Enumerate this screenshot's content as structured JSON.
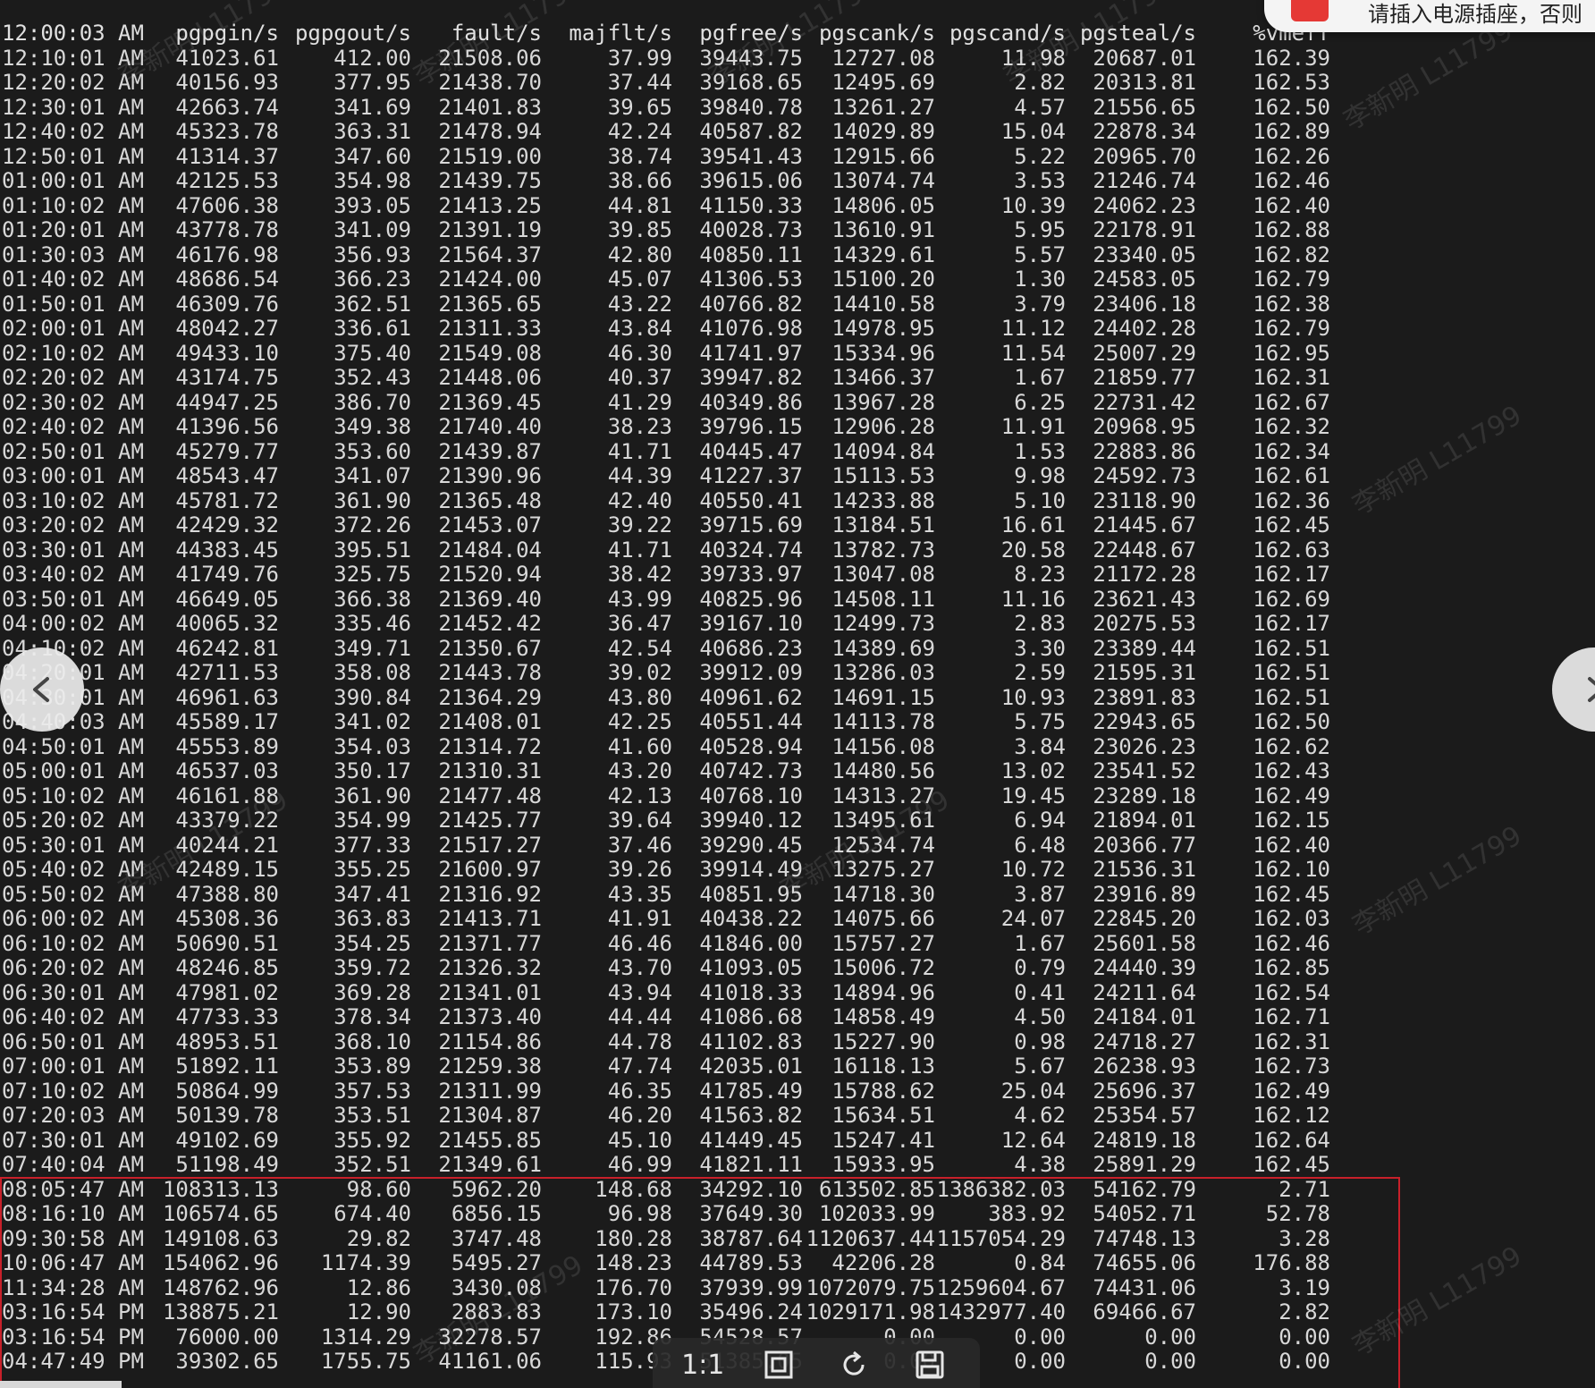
{
  "notification": {
    "text": "请插入电源插座，否则"
  },
  "watermark_text": "李新明 L11799",
  "terminal": {
    "headers": [
      "12:00:03 AM",
      "pgpgin/s",
      "pgpgout/s",
      "fault/s",
      "majflt/s",
      "pgfree/s",
      "pgscank/s",
      "pgscand/s",
      "pgsteal/s",
      "%vmeff"
    ],
    "rows": [
      [
        "12:10:01 AM",
        "41023.61",
        "412.00",
        "21508.06",
        "37.99",
        "39443.75",
        "12727.08",
        "11.98",
        "20687.01",
        "162.39"
      ],
      [
        "12:20:02 AM",
        "40156.93",
        "377.95",
        "21438.70",
        "37.44",
        "39168.65",
        "12495.69",
        "2.82",
        "20313.81",
        "162.53"
      ],
      [
        "12:30:01 AM",
        "42663.74",
        "341.69",
        "21401.83",
        "39.65",
        "39840.78",
        "13261.27",
        "4.57",
        "21556.65",
        "162.50"
      ],
      [
        "12:40:02 AM",
        "45323.78",
        "363.31",
        "21478.94",
        "42.24",
        "40587.82",
        "14029.89",
        "15.04",
        "22878.34",
        "162.89"
      ],
      [
        "12:50:01 AM",
        "41314.37",
        "347.60",
        "21519.00",
        "38.74",
        "39541.43",
        "12915.66",
        "5.22",
        "20965.70",
        "162.26"
      ],
      [
        "01:00:01 AM",
        "42125.53",
        "354.98",
        "21439.75",
        "38.66",
        "39615.06",
        "13074.74",
        "3.53",
        "21246.74",
        "162.46"
      ],
      [
        "01:10:02 AM",
        "47606.38",
        "393.05",
        "21413.25",
        "44.81",
        "41150.33",
        "14806.05",
        "10.39",
        "24062.23",
        "162.40"
      ],
      [
        "01:20:01 AM",
        "43778.78",
        "341.09",
        "21391.19",
        "39.85",
        "40028.73",
        "13610.91",
        "5.95",
        "22178.91",
        "162.88"
      ],
      [
        "01:30:03 AM",
        "46176.98",
        "356.93",
        "21564.37",
        "42.80",
        "40850.11",
        "14329.61",
        "5.57",
        "23340.05",
        "162.82"
      ],
      [
        "01:40:02 AM",
        "48686.54",
        "366.23",
        "21424.00",
        "45.07",
        "41306.53",
        "15100.20",
        "1.30",
        "24583.05",
        "162.79"
      ],
      [
        "01:50:01 AM",
        "46309.76",
        "362.51",
        "21365.65",
        "43.22",
        "40766.82",
        "14410.58",
        "3.79",
        "23406.18",
        "162.38"
      ],
      [
        "02:00:01 AM",
        "48042.27",
        "336.61",
        "21311.33",
        "43.84",
        "41076.98",
        "14978.95",
        "11.12",
        "24402.28",
        "162.79"
      ],
      [
        "02:10:02 AM",
        "49433.10",
        "375.40",
        "21549.08",
        "46.30",
        "41741.97",
        "15334.96",
        "11.54",
        "25007.29",
        "162.95"
      ],
      [
        "02:20:02 AM",
        "43174.75",
        "352.43",
        "21448.06",
        "40.37",
        "39947.82",
        "13466.37",
        "1.67",
        "21859.77",
        "162.31"
      ],
      [
        "02:30:02 AM",
        "44947.25",
        "386.70",
        "21369.45",
        "41.29",
        "40349.86",
        "13967.28",
        "6.25",
        "22731.42",
        "162.67"
      ],
      [
        "02:40:02 AM",
        "41396.56",
        "349.38",
        "21740.40",
        "38.23",
        "39796.15",
        "12906.28",
        "11.91",
        "20968.95",
        "162.32"
      ],
      [
        "02:50:01 AM",
        "45279.77",
        "353.60",
        "21439.87",
        "41.71",
        "40445.47",
        "14094.84",
        "1.53",
        "22883.86",
        "162.34"
      ],
      [
        "03:00:01 AM",
        "48543.47",
        "341.07",
        "21390.96",
        "44.39",
        "41227.37",
        "15113.53",
        "9.98",
        "24592.73",
        "162.61"
      ],
      [
        "03:10:02 AM",
        "45781.72",
        "361.90",
        "21365.48",
        "42.40",
        "40550.41",
        "14233.88",
        "5.10",
        "23118.90",
        "162.36"
      ],
      [
        "03:20:02 AM",
        "42429.32",
        "372.26",
        "21453.07",
        "39.22",
        "39715.69",
        "13184.51",
        "16.61",
        "21445.67",
        "162.45"
      ],
      [
        "03:30:01 AM",
        "44383.45",
        "395.51",
        "21484.04",
        "41.71",
        "40324.74",
        "13782.73",
        "20.58",
        "22448.67",
        "162.63"
      ],
      [
        "03:40:02 AM",
        "41749.76",
        "325.75",
        "21520.94",
        "38.42",
        "39733.97",
        "13047.08",
        "8.23",
        "21172.28",
        "162.17"
      ],
      [
        "03:50:01 AM",
        "46649.05",
        "366.38",
        "21369.40",
        "43.99",
        "40825.96",
        "14508.11",
        "11.16",
        "23621.43",
        "162.69"
      ],
      [
        "04:00:02 AM",
        "40065.32",
        "335.46",
        "21452.42",
        "36.47",
        "39167.10",
        "12499.73",
        "2.83",
        "20275.53",
        "162.17"
      ],
      [
        "04:10:02 AM",
        "46242.81",
        "349.71",
        "21350.67",
        "42.54",
        "40686.23",
        "14389.69",
        "3.30",
        "23389.44",
        "162.51"
      ],
      [
        "04:20:01 AM",
        "42711.53",
        "358.08",
        "21443.78",
        "39.02",
        "39912.09",
        "13286.03",
        "2.59",
        "21595.31",
        "162.51"
      ],
      [
        "04:30:01 AM",
        "46961.63",
        "390.84",
        "21364.29",
        "43.80",
        "40961.62",
        "14691.15",
        "10.93",
        "23891.83",
        "162.51"
      ],
      [
        "04:40:03 AM",
        "45589.17",
        "341.02",
        "21408.01",
        "42.25",
        "40551.44",
        "14113.78",
        "5.75",
        "22943.65",
        "162.50"
      ],
      [
        "04:50:01 AM",
        "45553.89",
        "354.03",
        "21314.72",
        "41.60",
        "40528.94",
        "14156.08",
        "3.84",
        "23026.23",
        "162.62"
      ],
      [
        "05:00:01 AM",
        "46537.03",
        "350.17",
        "21310.31",
        "43.20",
        "40742.73",
        "14480.56",
        "13.02",
        "23541.52",
        "162.43"
      ],
      [
        "05:10:02 AM",
        "46161.88",
        "361.90",
        "21477.48",
        "42.13",
        "40768.10",
        "14313.27",
        "19.45",
        "23289.18",
        "162.49"
      ],
      [
        "05:20:02 AM",
        "43379.22",
        "354.99",
        "21425.77",
        "39.64",
        "39940.12",
        "13495.61",
        "6.94",
        "21894.01",
        "162.15"
      ],
      [
        "05:30:01 AM",
        "40244.21",
        "377.33",
        "21517.27",
        "37.46",
        "39290.45",
        "12534.74",
        "6.48",
        "20366.77",
        "162.40"
      ],
      [
        "05:40:02 AM",
        "42489.15",
        "355.25",
        "21600.97",
        "39.26",
        "39914.49",
        "13275.27",
        "10.72",
        "21536.31",
        "162.10"
      ],
      [
        "05:50:02 AM",
        "47388.80",
        "347.41",
        "21316.92",
        "43.35",
        "40851.95",
        "14718.30",
        "3.87",
        "23916.89",
        "162.45"
      ],
      [
        "06:00:02 AM",
        "45308.36",
        "363.83",
        "21413.71",
        "41.91",
        "40438.22",
        "14075.66",
        "24.07",
        "22845.20",
        "162.03"
      ],
      [
        "06:10:02 AM",
        "50690.51",
        "354.25",
        "21371.77",
        "46.46",
        "41846.00",
        "15757.27",
        "1.67",
        "25601.58",
        "162.46"
      ],
      [
        "06:20:02 AM",
        "48246.85",
        "359.72",
        "21326.32",
        "43.70",
        "41093.05",
        "15006.72",
        "0.79",
        "24440.39",
        "162.85"
      ],
      [
        "06:30:01 AM",
        "47981.02",
        "369.28",
        "21341.01",
        "43.94",
        "41018.33",
        "14894.96",
        "0.41",
        "24211.64",
        "162.54"
      ],
      [
        "06:40:02 AM",
        "47733.33",
        "378.34",
        "21373.40",
        "44.44",
        "41086.68",
        "14858.49",
        "4.50",
        "24184.01",
        "162.71"
      ],
      [
        "06:50:01 AM",
        "48953.51",
        "368.10",
        "21154.86",
        "44.78",
        "41102.83",
        "15227.90",
        "0.98",
        "24718.27",
        "162.31"
      ],
      [
        "07:00:01 AM",
        "51892.11",
        "353.89",
        "21259.38",
        "47.74",
        "42035.01",
        "16118.13",
        "5.67",
        "26238.93",
        "162.73"
      ],
      [
        "07:10:02 AM",
        "50864.99",
        "357.53",
        "21311.99",
        "46.35",
        "41785.49",
        "15788.62",
        "25.04",
        "25696.37",
        "162.49"
      ],
      [
        "07:20:03 AM",
        "50139.78",
        "353.51",
        "21304.87",
        "46.20",
        "41563.82",
        "15634.51",
        "4.62",
        "25354.57",
        "162.12"
      ],
      [
        "07:30:01 AM",
        "49102.69",
        "355.92",
        "21455.85",
        "45.10",
        "41449.45",
        "15247.41",
        "12.64",
        "24819.18",
        "162.64"
      ],
      [
        "07:40:04 AM",
        "51198.49",
        "352.51",
        "21349.61",
        "46.99",
        "41821.11",
        "15933.95",
        "4.38",
        "25891.29",
        "162.45"
      ]
    ],
    "highlighted_rows": [
      [
        "08:05:47 AM",
        "108313.13",
        "98.60",
        "5962.20",
        "148.68",
        "34292.10",
        "613502.85",
        "1386382.03",
        "54162.79",
        "2.71"
      ],
      [
        "08:16:10 AM",
        "106574.65",
        "674.40",
        "6856.15",
        "96.98",
        "37649.30",
        "102033.99",
        "383.92",
        "54052.71",
        "52.78"
      ],
      [
        "09:30:58 AM",
        "149108.63",
        "29.82",
        "3747.48",
        "180.28",
        "38787.64",
        "1120637.44",
        "1157054.29",
        "74748.13",
        "3.28"
      ],
      [
        "10:06:47 AM",
        "154062.96",
        "1174.39",
        "5495.27",
        "148.23",
        "44789.53",
        "42206.28",
        "0.84",
        "74655.06",
        "176.88"
      ],
      [
        "11:34:28 AM",
        "148762.96",
        "12.86",
        "3430.08",
        "176.70",
        "37939.99",
        "1072079.75",
        "1259604.67",
        "74431.06",
        "3.19"
      ],
      [
        "03:16:54 PM",
        "138875.21",
        "12.90",
        "2883.83",
        "173.10",
        "35496.24",
        "1029171.98",
        "1432977.40",
        "69466.67",
        "2.82"
      ],
      [
        "03:16:54 PM",
        "76000.00",
        "1314.29",
        "32278.57",
        "192.86",
        "54528.57",
        "0.00",
        "0.00",
        "0.00",
        "0.00"
      ],
      [
        "04:47:49 PM",
        "39302.65",
        "1755.75",
        "41161.06",
        "115.93",
        "51385.05",
        "0.00",
        "0.00",
        "0.00",
        "0.00"
      ]
    ]
  },
  "toolbar": {
    "items": [
      {
        "label": "1:1",
        "icon": "actual-size-icon"
      },
      {
        "label": "⊡",
        "icon": "fit-window-icon"
      },
      {
        "label": "↻",
        "icon": "rotate-icon"
      },
      {
        "label": "💾",
        "icon": "save-icon"
      }
    ]
  },
  "nav": {
    "prev_glyph": "‹",
    "next_glyph": "›"
  }
}
